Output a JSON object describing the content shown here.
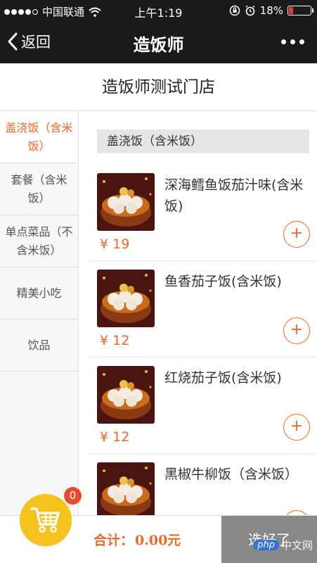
{
  "status_bar": {
    "carrier": "中国联通",
    "time": "上午1:19",
    "battery": "18%",
    "signal_icon": "signal-dots-icon",
    "wifi_icon": "wifi-icon",
    "lock_icon": "rotation-lock-icon",
    "alarm_icon": "alarm-icon",
    "battery_color": "#e23b3b"
  },
  "nav": {
    "back_label": "返回",
    "title": "造饭师",
    "more_icon": "more-dots-icon"
  },
  "shop": {
    "name": "造饭师测试门店"
  },
  "sidebar": {
    "categories": [
      {
        "label": "盖浇饭（含米饭）",
        "active": true
      },
      {
        "label": "套餐（含米饭）",
        "active": false
      },
      {
        "label": "单点菜品（不含米饭）",
        "active": false
      },
      {
        "label": "精美小吃",
        "active": false
      },
      {
        "label": "饮品",
        "active": false
      }
    ]
  },
  "main": {
    "section_title": "盖浇饭（含米饭）",
    "items": [
      {
        "name": "深海鳕鱼饭茄汁味(含米饭)",
        "price": "¥ 19",
        "add_label": "+"
      },
      {
        "name": "鱼香茄子饭(含米饭)",
        "price": "¥ 12",
        "add_label": "+"
      },
      {
        "name": "红烧茄子饭(含米饭)",
        "price": "¥ 12",
        "add_label": "+"
      },
      {
        "name": "黑椒牛柳饭（含米饭）",
        "price": "",
        "add_label": "+"
      }
    ]
  },
  "cart": {
    "badge_count": "0",
    "icon": "cart-icon",
    "color": "#f6c31e"
  },
  "footer": {
    "total_label": "合计：",
    "total_value": "0.00元",
    "checkout_label": "选好了"
  },
  "watermark": {
    "logo": "php",
    "text": "中文网"
  },
  "colors": {
    "accent": "#e8692c",
    "nav_bg": "#1a1a1a",
    "checkout_bg": "#888888"
  }
}
